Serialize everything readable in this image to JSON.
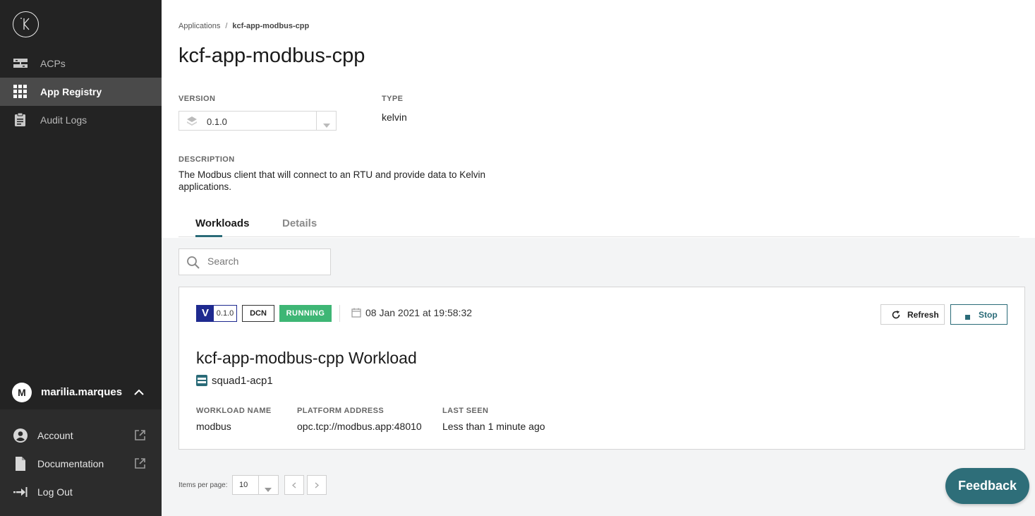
{
  "sidebar": {
    "nav": [
      {
        "label": "ACPs",
        "icon": "acp-icon"
      },
      {
        "label": "App Registry",
        "icon": "grid-icon",
        "active": true
      },
      {
        "label": "Audit Logs",
        "icon": "clipboard-icon"
      }
    ],
    "user": {
      "initial": "M",
      "name": "marilia.marques"
    },
    "lower": [
      {
        "label": "Account",
        "icon": "user-circle-icon"
      },
      {
        "label": "Documentation",
        "icon": "document-icon"
      },
      {
        "label": "Log Out",
        "icon": "logout-icon"
      }
    ]
  },
  "breadcrumb": {
    "root": "Applications",
    "separator": "/",
    "current": "kcf-app-modbus-cpp"
  },
  "page_title": "kcf-app-modbus-cpp",
  "fields": {
    "version_label": "VERSION",
    "version_value": "0.1.0",
    "type_label": "TYPE",
    "type_value": "kelvin",
    "description_label": "DESCRIPTION",
    "description_value": "The Modbus client that will connect to an RTU and provide data to Kelvin applications."
  },
  "tabs": [
    {
      "label": "Workloads",
      "active": true
    },
    {
      "label": "Details",
      "active": false
    }
  ],
  "search": {
    "placeholder": "Search"
  },
  "workload": {
    "version_badge": "V",
    "version": "0.1.0",
    "dcn_badge": "DCN",
    "status": "RUNNING",
    "datetime": "08 Jan 2021 at 19:58:32",
    "refresh_label": "Refresh",
    "stop_label": "Stop",
    "title": "kcf-app-modbus-cpp Workload",
    "acp": "squad1-acp1",
    "columns": [
      {
        "label": "WORKLOAD NAME",
        "value": "modbus"
      },
      {
        "label": "PLATFORM ADDRESS",
        "value": "opc.tcp://modbus.app:48010"
      },
      {
        "label": "LAST SEEN",
        "value": "Less than 1 minute ago"
      }
    ]
  },
  "pagination": {
    "items_per_page_label": "Items per page:",
    "items_per_page": "10"
  },
  "feedback_label": "Feedback",
  "colors": {
    "accent": "#2a6b78",
    "running": "#3eb675",
    "version_badge": "#1e2a8f",
    "sidebar": "#232323"
  }
}
